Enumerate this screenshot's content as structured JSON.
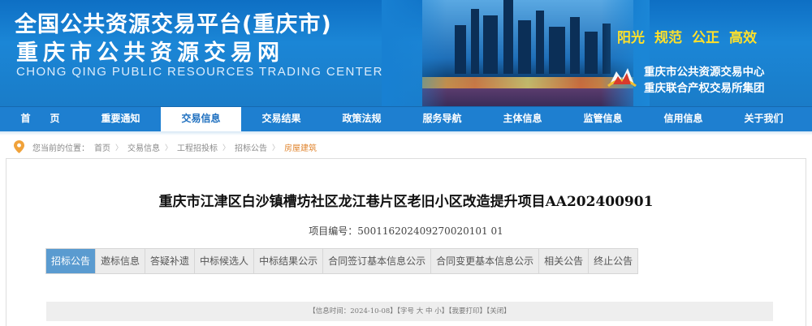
{
  "banner": {
    "title_line1": "全国公共资源交易平台(重庆市)",
    "title_line2": "重庆市公共资源交易网",
    "subtitle": "CHONG QING PUBLIC RESOURCES TRADING CENTER",
    "slogans": [
      "阳光",
      "规范",
      "公正",
      "高效"
    ],
    "org_line1": "重庆市公共资源交易中心",
    "org_line2": "重庆联合产权交易所集团",
    "slogan_color": "#ffe02a"
  },
  "nav": {
    "items": [
      {
        "label": "首　　页"
      },
      {
        "label": "重要通知"
      },
      {
        "label": "交易信息"
      },
      {
        "label": "交易结果"
      },
      {
        "label": "政策法规"
      },
      {
        "label": "服务导航"
      },
      {
        "label": "主体信息"
      },
      {
        "label": "监管信息"
      },
      {
        "label": "信用信息"
      },
      {
        "label": "关于我们"
      }
    ],
    "active_index": 2,
    "bg_color": "#1e7fd0"
  },
  "breadcrumb": {
    "label": "您当前的位置：",
    "items": [
      "首页",
      "交易信息",
      "工程招投标",
      "招标公告",
      "房屋建筑"
    ],
    "pin_icon": "location-pin-icon"
  },
  "main": {
    "title": "重庆市江津区白沙镇槽坊社区龙江巷片区老旧小区改造提升项目AA202400901",
    "project_no_label": "项目编号：",
    "project_no": "500116202409270020101 01",
    "tabs": [
      {
        "label": "招标公告"
      },
      {
        "label": "邀标信息"
      },
      {
        "label": "答疑补遗"
      },
      {
        "label": "中标候选人"
      },
      {
        "label": "中标结果公示"
      },
      {
        "label": "合同签订基本信息公示"
      },
      {
        "label": "合同变更基本信息公示"
      },
      {
        "label": "相关公告"
      },
      {
        "label": "终止公告"
      }
    ],
    "active_tab": 0,
    "active_tab_color": "#5a9bd0",
    "info": {
      "date_text": "【信息时间：2024-10-08】",
      "font_text": "【字号",
      "font_large": "大",
      "font_mid": "中",
      "font_small": "小】",
      "print_text": "【我要打印】",
      "close_text": "【关闭】"
    }
  }
}
